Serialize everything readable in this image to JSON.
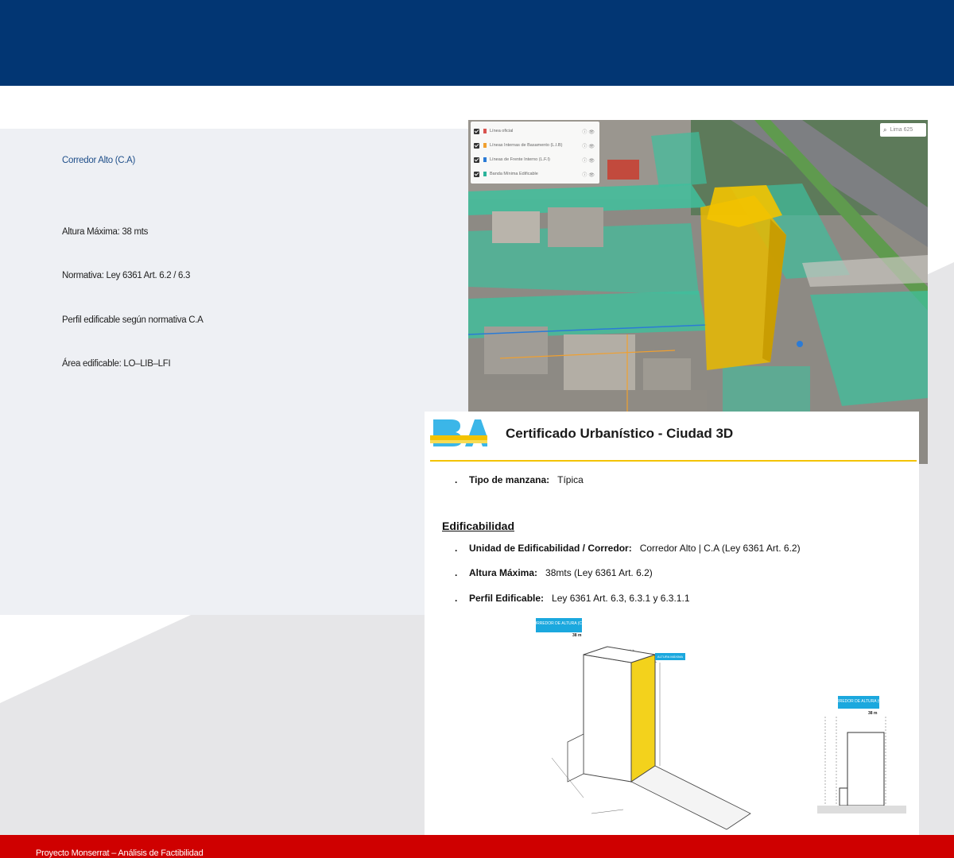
{
  "panel": {
    "corridor": "Corredor Alto (C.A)",
    "height": "Altura Máxima: 38 mts",
    "norm": "Normativa: Ley 6361 Art. 6.2 / 6.3",
    "profile": "Perfil edificable según normativa C.A",
    "area": "Área edificable: LO–LIB–LFI"
  },
  "map": {
    "search_placeholder": "Lima 625",
    "layers": [
      {
        "label": "Línea oficial",
        "color": "#d9534f"
      },
      {
        "label": "Líneas Internas de Basamento (L.I.B)",
        "color": "#f0a030"
      },
      {
        "label": "Líneas de Frente Interno (L.F.I)",
        "color": "#2b7bd6"
      },
      {
        "label": "Banda Mínima Edificable",
        "color": "#2bb39a"
      }
    ]
  },
  "certificate": {
    "title": "Certificado Urbanístico - Ciudad 3D",
    "block_type_label": "Tipo de manzana:",
    "block_type_value": "Típica",
    "section_heading": "Edificabilidad",
    "unit_label": "Unidad de Edificabilidad / Corredor:",
    "unit_value": "Corredor Alto | C.A (Ley 6361 Art. 6.2)",
    "height_label": "Altura Máxima:",
    "height_value": "38mts (Ley 6361 Art. 6.2)",
    "profile_label": "Perfil Edificable:",
    "profile_value": "Ley 6361 Art. 6.3, 6.3.1 y 6.3.1.1",
    "diagram": {
      "tag_corridor": "CORREDOR DE ALTURA (C.A)",
      "tag_height": "38 m",
      "tag_max": "ALTURA MÁXIMA"
    }
  },
  "colors": {
    "header": "#023673",
    "footer": "#cf0000",
    "panel": "#eef0f4",
    "accent_yellow": "#f3c300",
    "accent_teal": "#2bb39a"
  },
  "footer": {
    "text": "Proyecto Monserrat – Análisis de Factibilidad"
  }
}
